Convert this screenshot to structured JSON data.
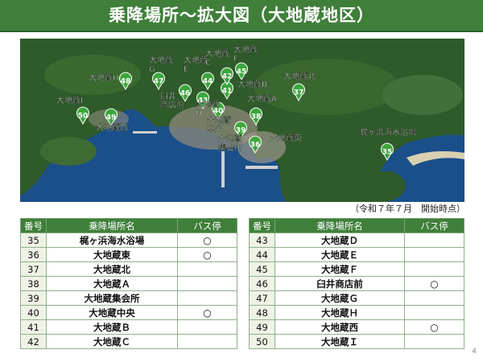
{
  "title": "乗降場所〜拡大図（大地蔵地区）",
  "note": "（令和７年７月　開始時点）",
  "page_number": "4",
  "headers": {
    "num": "番号",
    "name": "乗降場所名",
    "bus": "バス停"
  },
  "stops_left": [
    {
      "num": "35",
      "name": "梶ヶ浜海水浴場",
      "bus": "○"
    },
    {
      "num": "36",
      "name": "大地蔵東",
      "bus": "○"
    },
    {
      "num": "37",
      "name": "大地蔵北",
      "bus": ""
    },
    {
      "num": "38",
      "name": "大地蔵Ａ",
      "bus": ""
    },
    {
      "num": "39",
      "name": "大地蔵集会所",
      "bus": ""
    },
    {
      "num": "40",
      "name": "大地蔵中央",
      "bus": "○"
    },
    {
      "num": "41",
      "name": "大地蔵Ｂ",
      "bus": ""
    },
    {
      "num": "42",
      "name": "大地蔵Ｃ",
      "bus": ""
    }
  ],
  "stops_right": [
    {
      "num": "43",
      "name": "大地蔵Ｄ",
      "bus": ""
    },
    {
      "num": "44",
      "name": "大地蔵Ｅ",
      "bus": ""
    },
    {
      "num": "45",
      "name": "大地蔵Ｆ",
      "bus": ""
    },
    {
      "num": "46",
      "name": "臼井商店前",
      "bus": "○"
    },
    {
      "num": "47",
      "name": "大地蔵Ｇ",
      "bus": ""
    },
    {
      "num": "48",
      "name": "大地蔵Ｈ",
      "bus": ""
    },
    {
      "num": "49",
      "name": "大地蔵西",
      "bus": "○"
    },
    {
      "num": "50",
      "name": "大地蔵Ｉ",
      "bus": ""
    }
  ],
  "map": {
    "colors": {
      "sea": "#1a4f8a",
      "land": "#2f5a2a",
      "marker": "#3ca63c"
    },
    "markers": [
      "35",
      "36",
      "37",
      "38",
      "39",
      "40",
      "41",
      "42",
      "43",
      "44",
      "45",
      "46",
      "47",
      "48",
      "49",
      "50"
    ],
    "labels": [
      {
        "id": "l43",
        "text": "大地蔵\nD"
      },
      {
        "id": "l44",
        "text": "大地蔵\nE"
      },
      {
        "id": "l45",
        "text": "大地蔵\nF"
      },
      {
        "id": "l47",
        "text": "大地蔵\nG"
      },
      {
        "id": "l48",
        "text": "大地蔵H"
      },
      {
        "id": "l41",
        "text": "大地蔵B"
      },
      {
        "id": "l37",
        "text": "大地蔵北"
      },
      {
        "id": "l38",
        "text": "大地蔵A"
      },
      {
        "id": "l50",
        "text": "大地蔵I"
      },
      {
        "id": "l46",
        "text": "臼井\n商店前"
      },
      {
        "id": "l42",
        "text": "大地蔵\nC"
      },
      {
        "id": "l40",
        "text": "大地蔵\n中央"
      },
      {
        "id": "l49",
        "text": "大地蔵西"
      },
      {
        "id": "l39",
        "text": "大地蔵\n集会所"
      },
      {
        "id": "l36",
        "text": "大地蔵東"
      },
      {
        "id": "l35",
        "text": "梶ヶ浜海水浴場"
      }
    ]
  }
}
